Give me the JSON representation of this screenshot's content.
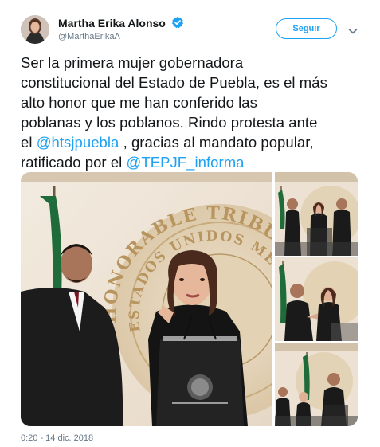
{
  "user": {
    "display_name": "Martha Erika Alonso",
    "handle": "@MarthaErikaA",
    "verified": true
  },
  "follow_button": {
    "label": "Seguir"
  },
  "icons": {
    "verified": "verified-badge-icon",
    "more": "chevron-down-icon"
  },
  "tweet": {
    "l1": "Ser la primera mujer gobernadora",
    "l2": "constitucional del Estado de Puebla, es el más",
    "l3": "alto honor que me han conferido las",
    "l4": "poblanas y los poblanos. Rindo protesta ante",
    "l5_pre": "el ",
    "l5_mention": "@htsjpuebla",
    "l5_post": " , gracias al mandato popular,",
    "l6_pre": "ratificado por el ",
    "l6_mention": "@TEPJF_informa"
  },
  "media": {
    "seal_text_1": "HONORABLE TRIBUNAL",
    "seal_text_2": "ESTADOS UNIDOS MEXICANOS"
  },
  "timestamp": "0:20 - 14 dic. 2018",
  "colors": {
    "accent": "#1da1f2",
    "muted": "#657786",
    "text": "#14171a"
  }
}
